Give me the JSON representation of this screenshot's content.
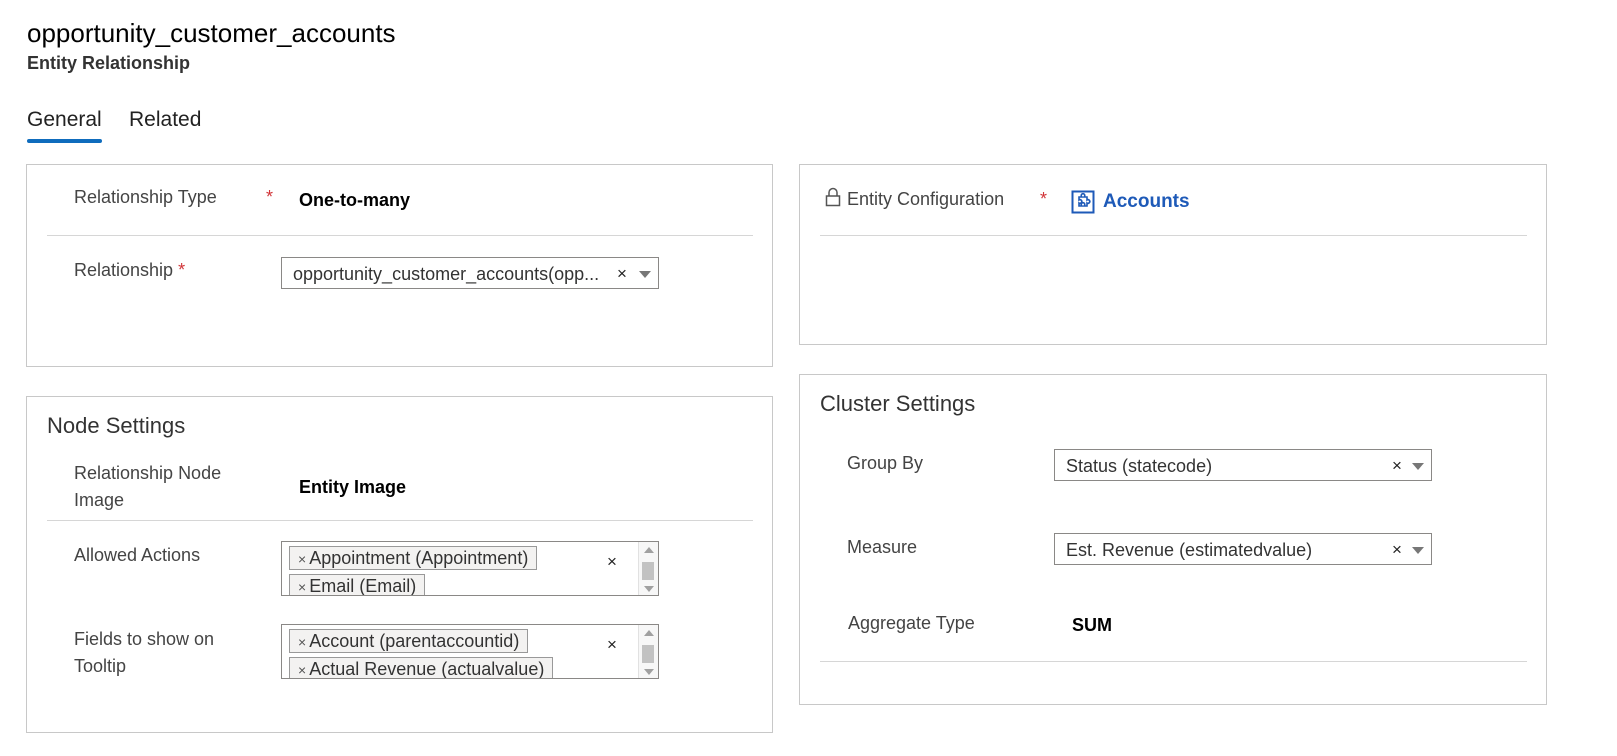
{
  "header": {
    "title": "opportunity_customer_accounts",
    "subtitle": "Entity Relationship"
  },
  "tabs": [
    {
      "label": "General",
      "active": true
    },
    {
      "label": "Related",
      "active": false
    }
  ],
  "relationship_panel": {
    "relationship_type_label": "Relationship Type",
    "relationship_type_value": "One-to-many",
    "relationship_label": "Relationship",
    "relationship_value": "opportunity_customer_accounts(opp...",
    "required_mark": "*"
  },
  "entity_panel": {
    "label": "Entity Configuration",
    "required_mark": "*",
    "value": "Accounts",
    "value_icon": "entity-puzzle-icon",
    "lock_icon": "lock-icon"
  },
  "node_settings": {
    "title": "Node Settings",
    "node_image_label": "Relationship Node Image",
    "node_image_value": "Entity Image",
    "allowed_actions_label": "Allowed Actions",
    "allowed_actions": [
      "Appointment (Appointment)",
      "Email (Email)"
    ],
    "tooltip_label": "Fields to show on Tooltip",
    "tooltip_fields": [
      "Account (parentaccountid)",
      "Actual Revenue (actualvalue)"
    ]
  },
  "cluster_settings": {
    "title": "Cluster Settings",
    "group_by_label": "Group By",
    "group_by_value": "Status (statecode)",
    "measure_label": "Measure",
    "measure_value": "Est. Revenue (estimatedvalue)",
    "aggregate_label": "Aggregate Type",
    "aggregate_value": "SUM"
  },
  "glyphs": {
    "clear": "×",
    "chip_remove": "×"
  },
  "colors": {
    "accent": "#0f6cbd",
    "required": "#d13438",
    "link": "#1e5ab8"
  }
}
